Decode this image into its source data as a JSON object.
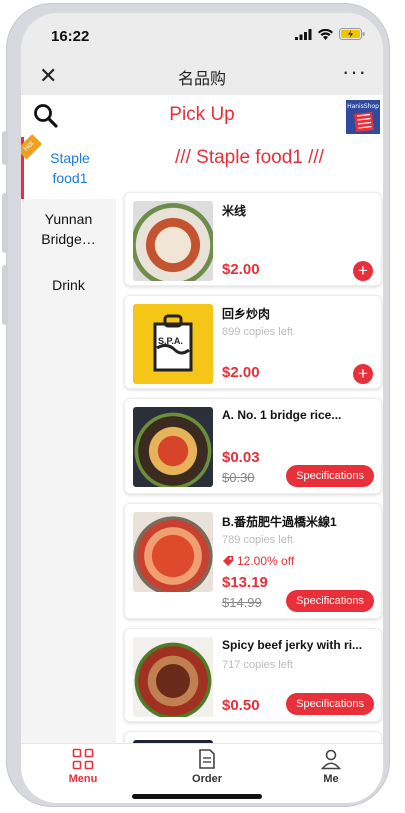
{
  "status_bar": {
    "time": "16:22"
  },
  "nav": {
    "close_icon": "close-icon",
    "title": "名品购",
    "more": "···"
  },
  "header": {
    "mode_title": "Pick Up",
    "logo_text": "HanisShop"
  },
  "sidebar": {
    "categories": [
      {
        "label": "Staple food1",
        "active": true,
        "badge": "Hot"
      },
      {
        "label": "Yunnan Bridge…",
        "active": false
      },
      {
        "label": "Drink",
        "active": false
      }
    ]
  },
  "section": {
    "title": "/// Staple food1 ///"
  },
  "products": [
    {
      "name": "米线",
      "copies": "",
      "discount": "",
      "price": "$2.00",
      "old_price": "",
      "action": "add"
    },
    {
      "name": "回乡炒肉",
      "copies": "899 copies left",
      "discount": "",
      "price": "$2.00",
      "old_price": "",
      "action": "add",
      "thumb_text": "S.P.A."
    },
    {
      "name": "A. No. 1 bridge rice...",
      "copies": "",
      "discount": "",
      "price": "$0.03",
      "old_price": "$0.30",
      "action": "Specifications"
    },
    {
      "name": "B.番茄肥牛過橋米線1",
      "copies": "789 copies left",
      "discount": "12.00% off",
      "price": "$13.19",
      "old_price": "$14.99",
      "action": "Specifications"
    },
    {
      "name": "Spicy beef jerky with ri...",
      "copies": "717 copies left",
      "discount": "",
      "price": "$0.50",
      "old_price": "",
      "action": "Specifications"
    }
  ],
  "tabbar": [
    {
      "label": "Menu",
      "icon": "grid-icon",
      "active": true
    },
    {
      "label": "Order",
      "icon": "document-icon",
      "active": false
    },
    {
      "label": "Me",
      "icon": "person-icon",
      "active": false
    }
  ],
  "colors": {
    "accent": "#e8303a",
    "active_category": "#1e7be0"
  }
}
